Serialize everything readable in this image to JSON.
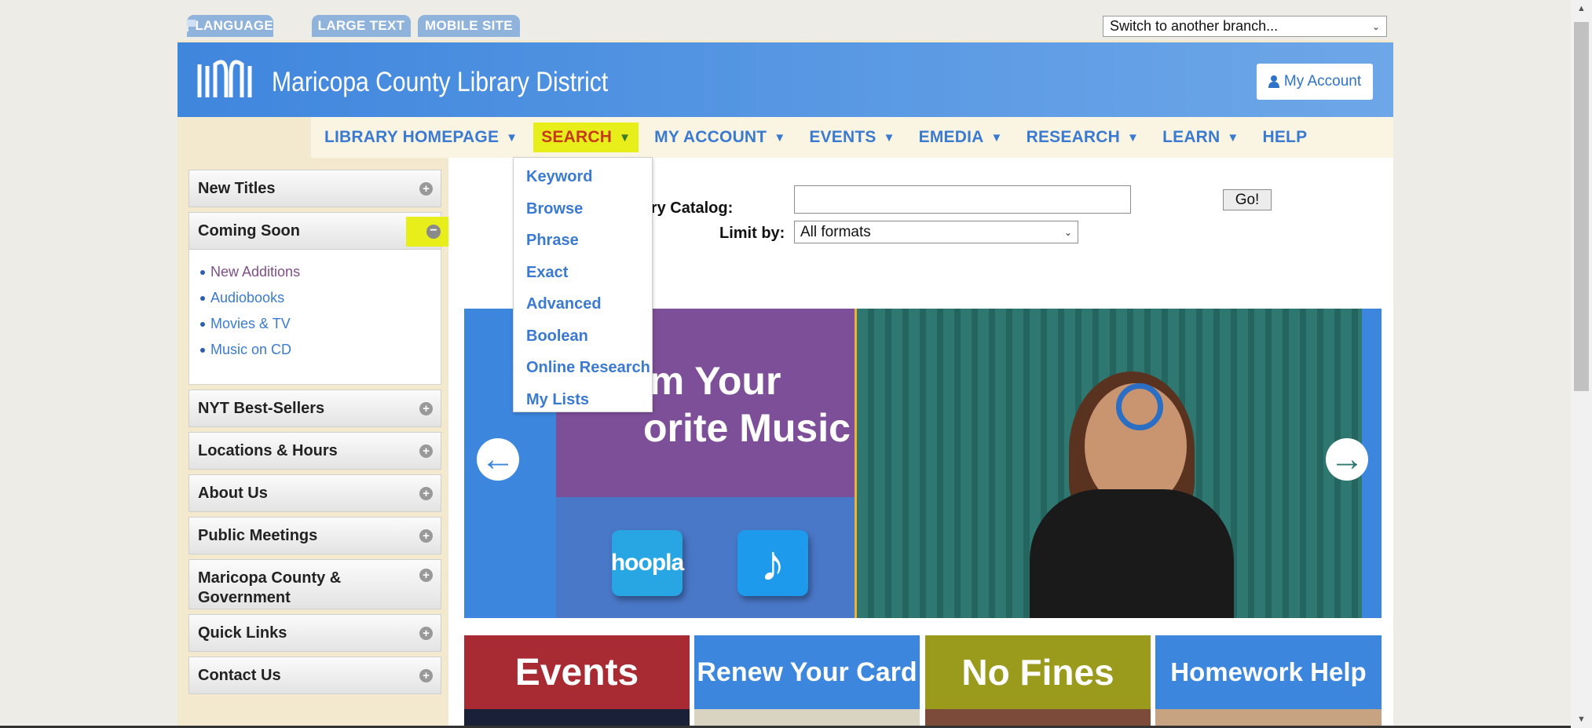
{
  "utility": {
    "language": "LANGUAGE",
    "large_text": "LARGE TEXT",
    "mobile_site": "MOBILE SITE",
    "branch_select": "Switch to another branch..."
  },
  "header": {
    "title": "Maricopa County Library District",
    "my_account": "My Account"
  },
  "nav": {
    "items": [
      {
        "label": "LIBRARY HOMEPAGE",
        "arrow": "▼"
      },
      {
        "label": "SEARCH",
        "arrow": "▼"
      },
      {
        "label": "MY ACCOUNT",
        "arrow": "▼"
      },
      {
        "label": "EVENTS",
        "arrow": "▼"
      },
      {
        "label": "EMEDIA",
        "arrow": "▼"
      },
      {
        "label": "RESEARCH",
        "arrow": "▼"
      },
      {
        "label": "LEARN",
        "arrow": "▼"
      },
      {
        "label": "HELP"
      }
    ]
  },
  "search_menu": {
    "items": [
      "Keyword",
      "Browse",
      "Phrase",
      "Exact",
      "Advanced",
      "Boolean",
      "Online Research",
      "My Lists"
    ]
  },
  "sidebar": {
    "new_titles": "New Titles",
    "coming_soon": "Coming Soon",
    "coming_soon_links": [
      "New Additions",
      "Audiobooks",
      "Movies & TV",
      "Music on CD"
    ],
    "sections": [
      "NYT Best-Sellers",
      "Locations & Hours",
      "About Us",
      "Public Meetings",
      "Maricopa County & Government",
      "Quick Links",
      "Contact Us"
    ]
  },
  "catalog": {
    "search_label": "ch Library Catalog:",
    "limit_label": "Limit by:",
    "limit_value": "All formats",
    "go": "Go!"
  },
  "carousel": {
    "slide_line1": "am Your",
    "slide_line2": "orite Music",
    "app1": "hoopla",
    "app2": "♪"
  },
  "tiles": [
    "Events",
    "Renew Your Card",
    "No Fines",
    "Homework Help"
  ],
  "colors": {
    "brand_blue": "#3c86dd",
    "highlight": "#e8ee1a",
    "link": "#3b7ad1"
  }
}
